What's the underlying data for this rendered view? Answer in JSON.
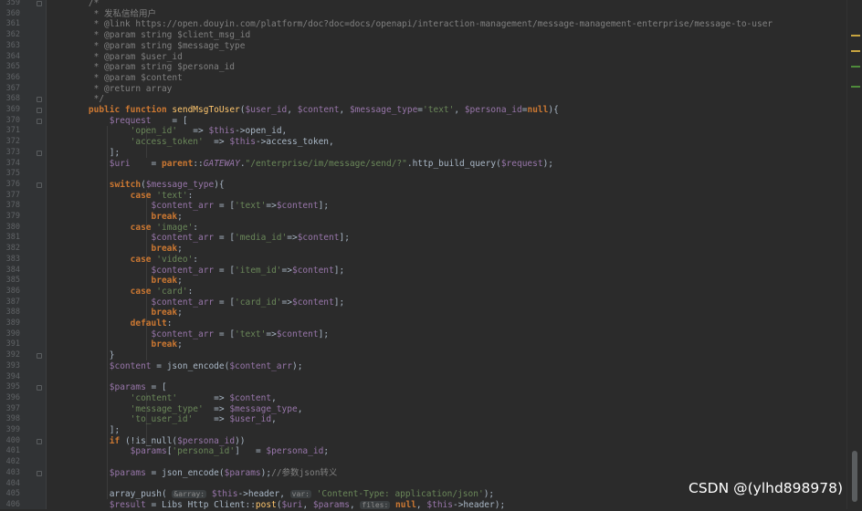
{
  "editor": {
    "line_numbers": [
      "359",
      "360",
      "361",
      "362",
      "363",
      "364",
      "365",
      "366",
      "367",
      "368",
      "369",
      "370",
      "371",
      "372",
      "373",
      "374",
      "375",
      "376",
      "377",
      "378",
      "379",
      "380",
      "381",
      "382",
      "383",
      "384",
      "385",
      "386",
      "387",
      "388",
      "389",
      "390",
      "391",
      "392",
      "393",
      "394",
      "395",
      "396",
      "397",
      "398",
      "399",
      "400",
      "401",
      "402",
      "403",
      "404",
      "405",
      "406"
    ],
    "code_lines": [
      [
        {
          "t": "    /*",
          "c": "cm"
        }
      ],
      [
        {
          "t": "     * 发私信给用户",
          "c": "cm"
        }
      ],
      [
        {
          "t": "     * @link https://open.douyin.com/platform/doc?doc=docs/openapi/interaction-management/message-management-enterprise/message-to-user",
          "c": "cm"
        }
      ],
      [
        {
          "t": "     * @param string $client_msg_id",
          "c": "cm"
        }
      ],
      [
        {
          "t": "     * @param string $message_type",
          "c": "cm"
        }
      ],
      [
        {
          "t": "     * @param $user_id",
          "c": "cm"
        }
      ],
      [
        {
          "t": "     * @param string $persona_id",
          "c": "cm"
        }
      ],
      [
        {
          "t": "     * @param $content",
          "c": "cm"
        }
      ],
      [
        {
          "t": "     * @return array",
          "c": "cm"
        }
      ],
      [
        {
          "t": "     */",
          "c": "cm"
        }
      ],
      [
        {
          "t": "    ",
          "c": ""
        },
        {
          "t": "public function ",
          "c": "kw"
        },
        {
          "t": "sendMsgToUser",
          "c": "fn"
        },
        {
          "t": "(",
          "c": ""
        },
        {
          "t": "$user_id",
          "c": "var"
        },
        {
          "t": ", ",
          "c": ""
        },
        {
          "t": "$content",
          "c": "var"
        },
        {
          "t": ", ",
          "c": ""
        },
        {
          "t": "$message_type",
          "c": "var"
        },
        {
          "t": "=",
          "c": ""
        },
        {
          "t": "'text'",
          "c": "str"
        },
        {
          "t": ", ",
          "c": ""
        },
        {
          "t": "$persona_id",
          "c": "var"
        },
        {
          "t": "=",
          "c": ""
        },
        {
          "t": "null",
          "c": "kw"
        },
        {
          "t": "){",
          "c": ""
        }
      ],
      [
        {
          "t": "        ",
          "c": ""
        },
        {
          "t": "$request",
          "c": "var"
        },
        {
          "t": "    = [",
          "c": ""
        }
      ],
      [
        {
          "t": "            ",
          "c": ""
        },
        {
          "t": "'open_id'",
          "c": "str"
        },
        {
          "t": "   => ",
          "c": ""
        },
        {
          "t": "$this",
          "c": "var"
        },
        {
          "t": "->open_id,",
          "c": ""
        }
      ],
      [
        {
          "t": "            ",
          "c": ""
        },
        {
          "t": "'access_token'",
          "c": "str"
        },
        {
          "t": "  => ",
          "c": ""
        },
        {
          "t": "$this",
          "c": "var"
        },
        {
          "t": "->access_token,",
          "c": ""
        }
      ],
      [
        {
          "t": "        ];",
          "c": ""
        }
      ],
      [
        {
          "t": "        ",
          "c": ""
        },
        {
          "t": "$uri",
          "c": "var"
        },
        {
          "t": "    = ",
          "c": ""
        },
        {
          "t": "parent",
          "c": "kw"
        },
        {
          "t": "::",
          "c": ""
        },
        {
          "t": "GATEWAY",
          "c": "const"
        },
        {
          "t": ".",
          "c": ""
        },
        {
          "t": "\"/enterprise/im/message/send/?\"",
          "c": "str"
        },
        {
          "t": ".http_build_query(",
          "c": ""
        },
        {
          "t": "$request",
          "c": "var"
        },
        {
          "t": ");",
          "c": ""
        }
      ],
      [
        {
          "t": "",
          "c": ""
        }
      ],
      [
        {
          "t": "        ",
          "c": ""
        },
        {
          "t": "switch",
          "c": "kw"
        },
        {
          "t": "(",
          "c": ""
        },
        {
          "t": "$message_type",
          "c": "var"
        },
        {
          "t": "){",
          "c": ""
        }
      ],
      [
        {
          "t": "            ",
          "c": ""
        },
        {
          "t": "case ",
          "c": "kw"
        },
        {
          "t": "'text'",
          "c": "str"
        },
        {
          "t": ":",
          "c": ""
        }
      ],
      [
        {
          "t": "                ",
          "c": ""
        },
        {
          "t": "$content_arr",
          "c": "var"
        },
        {
          "t": " = [",
          "c": ""
        },
        {
          "t": "'text'",
          "c": "str"
        },
        {
          "t": "=>",
          "c": ""
        },
        {
          "t": "$content",
          "c": "var"
        },
        {
          "t": "];",
          "c": ""
        }
      ],
      [
        {
          "t": "                ",
          "c": ""
        },
        {
          "t": "break",
          "c": "kw"
        },
        {
          "t": ";",
          "c": ""
        }
      ],
      [
        {
          "t": "            ",
          "c": ""
        },
        {
          "t": "case ",
          "c": "kw"
        },
        {
          "t": "'image'",
          "c": "str"
        },
        {
          "t": ":",
          "c": ""
        }
      ],
      [
        {
          "t": "                ",
          "c": ""
        },
        {
          "t": "$content_arr",
          "c": "var"
        },
        {
          "t": " = [",
          "c": ""
        },
        {
          "t": "'media_id'",
          "c": "str"
        },
        {
          "t": "=>",
          "c": ""
        },
        {
          "t": "$content",
          "c": "var"
        },
        {
          "t": "];",
          "c": ""
        }
      ],
      [
        {
          "t": "                ",
          "c": ""
        },
        {
          "t": "break",
          "c": "kw"
        },
        {
          "t": ";",
          "c": ""
        }
      ],
      [
        {
          "t": "            ",
          "c": ""
        },
        {
          "t": "case ",
          "c": "kw"
        },
        {
          "t": "'video'",
          "c": "str"
        },
        {
          "t": ":",
          "c": ""
        }
      ],
      [
        {
          "t": "                ",
          "c": ""
        },
        {
          "t": "$content_arr",
          "c": "var"
        },
        {
          "t": " = [",
          "c": ""
        },
        {
          "t": "'item_id'",
          "c": "str"
        },
        {
          "t": "=>",
          "c": ""
        },
        {
          "t": "$content",
          "c": "var"
        },
        {
          "t": "];",
          "c": ""
        }
      ],
      [
        {
          "t": "                ",
          "c": ""
        },
        {
          "t": "break",
          "c": "kw"
        },
        {
          "t": ";",
          "c": ""
        }
      ],
      [
        {
          "t": "            ",
          "c": ""
        },
        {
          "t": "case ",
          "c": "kw"
        },
        {
          "t": "'card'",
          "c": "str"
        },
        {
          "t": ":",
          "c": ""
        }
      ],
      [
        {
          "t": "                ",
          "c": ""
        },
        {
          "t": "$content_arr",
          "c": "var"
        },
        {
          "t": " = [",
          "c": ""
        },
        {
          "t": "'card_id'",
          "c": "str"
        },
        {
          "t": "=>",
          "c": ""
        },
        {
          "t": "$content",
          "c": "var"
        },
        {
          "t": "];",
          "c": ""
        }
      ],
      [
        {
          "t": "                ",
          "c": ""
        },
        {
          "t": "break",
          "c": "kw"
        },
        {
          "t": ";",
          "c": ""
        }
      ],
      [
        {
          "t": "            ",
          "c": ""
        },
        {
          "t": "default",
          "c": "kw"
        },
        {
          "t": ":",
          "c": ""
        }
      ],
      [
        {
          "t": "                ",
          "c": ""
        },
        {
          "t": "$content_arr",
          "c": "var"
        },
        {
          "t": " = [",
          "c": ""
        },
        {
          "t": "'text'",
          "c": "str"
        },
        {
          "t": "=>",
          "c": ""
        },
        {
          "t": "$content",
          "c": "var"
        },
        {
          "t": "];",
          "c": ""
        }
      ],
      [
        {
          "t": "                ",
          "c": ""
        },
        {
          "t": "break",
          "c": "kw"
        },
        {
          "t": ";",
          "c": ""
        }
      ],
      [
        {
          "t": "        }",
          "c": ""
        }
      ],
      [
        {
          "t": "        ",
          "c": ""
        },
        {
          "t": "$content",
          "c": "var"
        },
        {
          "t": " = json_encode(",
          "c": ""
        },
        {
          "t": "$content_arr",
          "c": "var"
        },
        {
          "t": ");",
          "c": ""
        }
      ],
      [
        {
          "t": "",
          "c": ""
        }
      ],
      [
        {
          "t": "        ",
          "c": ""
        },
        {
          "t": "$params",
          "c": "var"
        },
        {
          "t": " = [",
          "c": ""
        }
      ],
      [
        {
          "t": "            ",
          "c": ""
        },
        {
          "t": "'content'",
          "c": "str"
        },
        {
          "t": "       => ",
          "c": ""
        },
        {
          "t": "$content",
          "c": "var"
        },
        {
          "t": ",",
          "c": ""
        }
      ],
      [
        {
          "t": "            ",
          "c": ""
        },
        {
          "t": "'message_type'",
          "c": "str"
        },
        {
          "t": "  => ",
          "c": ""
        },
        {
          "t": "$message_type",
          "c": "var"
        },
        {
          "t": ",",
          "c": ""
        }
      ],
      [
        {
          "t": "            ",
          "c": ""
        },
        {
          "t": "'to_user_id'",
          "c": "str"
        },
        {
          "t": "    => ",
          "c": ""
        },
        {
          "t": "$user_id",
          "c": "var"
        },
        {
          "t": ",",
          "c": ""
        }
      ],
      [
        {
          "t": "        ];",
          "c": ""
        }
      ],
      [
        {
          "t": "        ",
          "c": ""
        },
        {
          "t": "if ",
          "c": "kw"
        },
        {
          "t": "(!is_null(",
          "c": ""
        },
        {
          "t": "$persona_id",
          "c": "var"
        },
        {
          "t": "))",
          "c": ""
        }
      ],
      [
        {
          "t": "            ",
          "c": ""
        },
        {
          "t": "$params",
          "c": "var"
        },
        {
          "t": "[",
          "c": ""
        },
        {
          "t": "'persona_id'",
          "c": "str"
        },
        {
          "t": "]   = ",
          "c": ""
        },
        {
          "t": "$persona_id",
          "c": "var"
        },
        {
          "t": ";",
          "c": ""
        }
      ],
      [
        {
          "t": "",
          "c": ""
        }
      ],
      [
        {
          "t": "        ",
          "c": ""
        },
        {
          "t": "$params",
          "c": "var"
        },
        {
          "t": " = json_encode(",
          "c": ""
        },
        {
          "t": "$params",
          "c": "var"
        },
        {
          "t": ");",
          "c": ""
        },
        {
          "t": "//参数json转义",
          "c": "cm"
        }
      ],
      [
        {
          "t": "",
          "c": ""
        }
      ],
      [
        {
          "t": "        array_push( ",
          "c": ""
        },
        {
          "t": "&array:",
          "c": "hint"
        },
        {
          "t": " ",
          "c": ""
        },
        {
          "t": "$this",
          "c": "var"
        },
        {
          "t": "->header, ",
          "c": ""
        },
        {
          "t": "var:",
          "c": "hint"
        },
        {
          "t": " ",
          "c": ""
        },
        {
          "t": "'Content-Type: application/json'",
          "c": "str"
        },
        {
          "t": ");",
          "c": ""
        }
      ],
      [
        {
          "t": "        ",
          "c": ""
        },
        {
          "t": "$result",
          "c": "var"
        },
        {
          "t": " = Libs_Http_Client::",
          "c": ""
        },
        {
          "t": "post",
          "c": "fn"
        },
        {
          "t": "(",
          "c": ""
        },
        {
          "t": "$uri",
          "c": "var"
        },
        {
          "t": ", ",
          "c": ""
        },
        {
          "t": "$params",
          "c": "var"
        },
        {
          "t": ", ",
          "c": ""
        },
        {
          "t": "files:",
          "c": "hint"
        },
        {
          "t": " ",
          "c": ""
        },
        {
          "t": "null",
          "c": "kw"
        },
        {
          "t": ", ",
          "c": ""
        },
        {
          "t": "$this",
          "c": "var"
        },
        {
          "t": "->header);",
          "c": ""
        }
      ]
    ]
  },
  "watermark": "CSDN @(ylhd898978)",
  "colors": {
    "background": "#2b2b2b",
    "gutter": "#313335",
    "comment": "#808080",
    "keyword": "#cc7832",
    "variable": "#9876aa",
    "string": "#6a8759",
    "function": "#ffc66d",
    "default_text": "#a9b7c6"
  }
}
